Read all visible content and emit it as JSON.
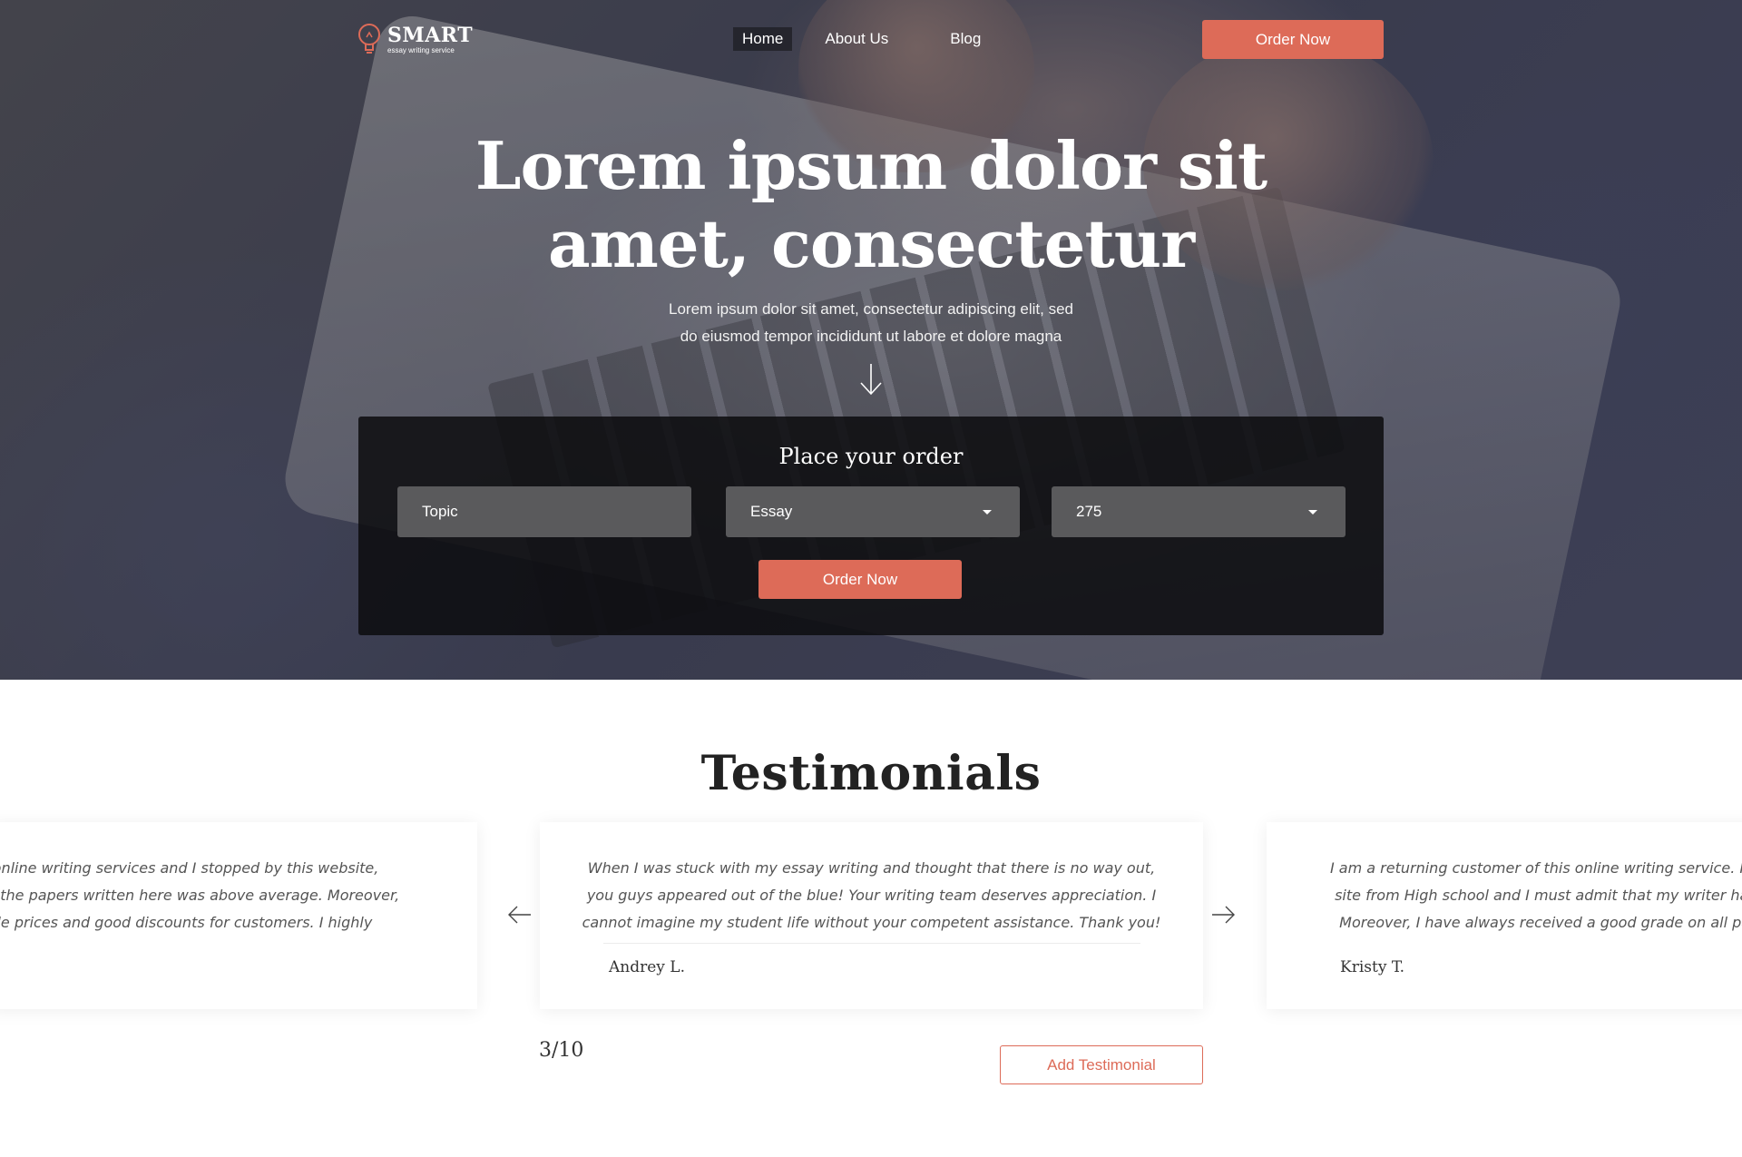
{
  "brand": {
    "name": "SMART",
    "tagline": "essay writing service",
    "accent_color": "#dd6b58",
    "logo_icon": "lightbulb-icon"
  },
  "nav": {
    "items": [
      {
        "label": "Home",
        "active": true
      },
      {
        "label": "About Us",
        "active": false
      },
      {
        "label": "Blog",
        "active": false
      }
    ],
    "cta_label": "Order Now"
  },
  "hero": {
    "title_line1": "Lorem ipsum dolor sit",
    "title_line2": "amet, consectetur",
    "subtitle_line1": "Lorem ipsum dolor sit amet, consectetur adipiscing elit, sed",
    "subtitle_line2": "do eiusmod tempor incididunt ut labore et dolore magna",
    "scroll_icon": "arrow-down-icon"
  },
  "order_form": {
    "title": "Place your order",
    "topic_placeholder": "Topic",
    "type_value": "Essay",
    "pages_value": "275",
    "submit_label": "Order Now"
  },
  "testimonials": {
    "title": "Testimonials",
    "cards": [
      {
        "text_line1": "ot of online writing services and I stopped by this website,",
        "text_line2": "lity of the papers written here was above average. Moreover,",
        "text_line3": "ordable prices and good discounts for customers. I highly",
        "author": ""
      },
      {
        "text_line1": "When I was stuck with my essay writing and thought that there is no way out,",
        "text_line2": "you guys appeared out of the blue! Your writing team deserves appreciation. I",
        "text_line3": "cannot imagine my student life without your competent assistance. Thank you!",
        "author": "Andrey L."
      },
      {
        "text_line1": "I am a returning customer of this online writing service. I hav",
        "text_line2": " site from High school and I must admit that my writer has n",
        "text_line3": "  Moreover, I have always received a good grade on all papers",
        "author": "Kristy T."
      }
    ],
    "pager": "3/10",
    "add_label": "Add Testimonial"
  }
}
